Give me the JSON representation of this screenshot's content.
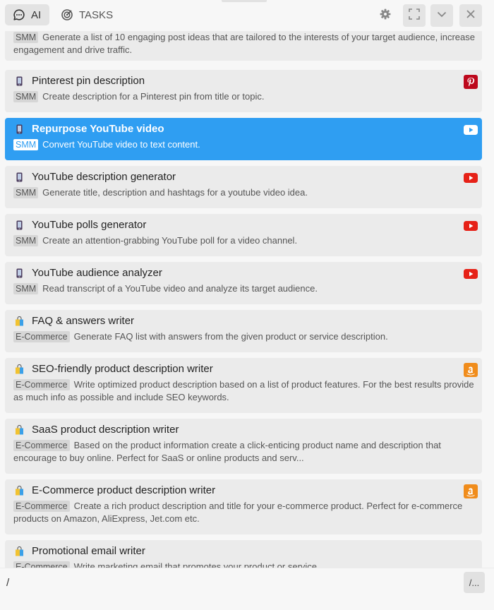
{
  "header": {
    "tabs": [
      {
        "label": "AI",
        "icon": "chat-icon",
        "active": true
      },
      {
        "label": "TASKS",
        "icon": "target-icon",
        "active": false
      }
    ],
    "icons": [
      "gear-icon",
      "expand-icon",
      "chevron-down-icon",
      "close-icon"
    ]
  },
  "colors": {
    "accent": "#2f9ef2",
    "card": "#ebebeb",
    "tag": "#d6d6d6",
    "youtube": "#e62117",
    "pinterest": "#bd081c",
    "amazon": "#f08c1b"
  },
  "cards": [
    {
      "title": "",
      "tag": "SMM",
      "desc": "Generate a list of 10 engaging post ideas that are tailored to the interests of your target audience, increase engagement and drive traffic.",
      "category_icon": "phone-icon",
      "brand": ""
    },
    {
      "title": "Pinterest pin description",
      "tag": "SMM",
      "desc": "Create description for a Pinterest pin from title or topic.",
      "category_icon": "phone-icon",
      "brand": "pinterest-icon"
    },
    {
      "title": "Repurpose YouTube video",
      "tag": "SMM",
      "desc": "Convert YouTube video to text content.",
      "category_icon": "phone-icon",
      "brand": "youtube-icon",
      "active": true
    },
    {
      "title": "YouTube description generator",
      "tag": "SMM",
      "desc": "Generate title, description and hashtags for a youtube video idea.",
      "category_icon": "phone-icon",
      "brand": "youtube-icon"
    },
    {
      "title": "YouTube polls generator",
      "tag": "SMM",
      "desc": "Create an attention-grabbing YouTube poll for a video channel.",
      "category_icon": "phone-icon",
      "brand": "youtube-icon"
    },
    {
      "title": "YouTube audience analyzer",
      "tag": "SMM",
      "desc": "Read transcript of a YouTube video and analyze its target audience.",
      "category_icon": "phone-icon",
      "brand": "youtube-icon"
    },
    {
      "title": "FAQ & answers writer",
      "tag": "E-Commerce",
      "desc": "Generate FAQ list with answers from the given product or service description.",
      "category_icon": "shopping-bag-icon",
      "brand": ""
    },
    {
      "title": "SEO-friendly product description writer",
      "tag": "E-Commerce",
      "desc": "Write optimized product description based on a list of product features. For the best results provide as much info as possible and include SEO keywords.",
      "category_icon": "shopping-bag-icon",
      "brand": "amazon-icon"
    },
    {
      "title": "SaaS product description writer",
      "tag": "E-Commerce",
      "desc": "Based on the product information create a click-enticing product name and description that encourage to buy online. Perfect for SaaS or online products and serv...",
      "category_icon": "shopping-bag-icon",
      "brand": ""
    },
    {
      "title": "E-Commerce product description writer",
      "tag": "E-Commerce",
      "desc": "Create a rich product description and title for your e-commerce product. Perfect for e-commerce products on Amazon, AliExpress, Jet.com etc.",
      "category_icon": "shopping-bag-icon",
      "brand": "amazon-icon"
    },
    {
      "title": "Promotional email writer",
      "tag": "E-Commerce",
      "desc": "Write marketing email that promotes your product or service",
      "category_icon": "shopping-bag-icon",
      "brand": ""
    }
  ],
  "composer": {
    "value": "/",
    "commands_label": "/..."
  }
}
